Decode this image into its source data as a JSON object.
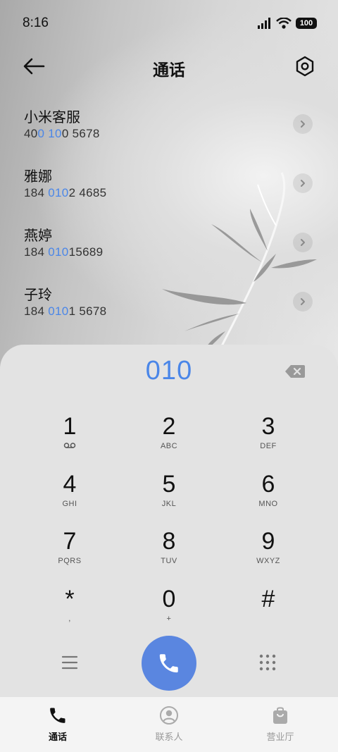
{
  "status_bar": {
    "time": "8:16",
    "battery": "100"
  },
  "header": {
    "title": "通话"
  },
  "results": [
    {
      "name": "小米客服",
      "number_parts": [
        "40",
        "0 10",
        "0 5678"
      ]
    },
    {
      "name": "雅娜",
      "number_parts": [
        "184 ",
        "010",
        "2 4685"
      ]
    },
    {
      "name": "燕婷",
      "number_parts": [
        "184 ",
        "010",
        "15689"
      ]
    },
    {
      "name": "子玲",
      "number_parts": [
        "184 ",
        "010",
        "1 5678"
      ]
    }
  ],
  "dialer": {
    "input": "010",
    "keys": [
      {
        "digit": "1",
        "letters": ""
      },
      {
        "digit": "2",
        "letters": "ABC"
      },
      {
        "digit": "3",
        "letters": "DEF"
      },
      {
        "digit": "4",
        "letters": "GHI"
      },
      {
        "digit": "5",
        "letters": "JKL"
      },
      {
        "digit": "6",
        "letters": "MNO"
      },
      {
        "digit": "7",
        "letters": "PQRS"
      },
      {
        "digit": "8",
        "letters": "TUV"
      },
      {
        "digit": "9",
        "letters": "WXYZ"
      },
      {
        "digit": "*",
        "letters": ","
      },
      {
        "digit": "0",
        "letters": "+"
      },
      {
        "digit": "#",
        "letters": ""
      }
    ]
  },
  "tabs": [
    {
      "label": "通话",
      "icon": "phone-icon",
      "active": true
    },
    {
      "label": "联系人",
      "icon": "contact-icon",
      "active": false
    },
    {
      "label": "营业厅",
      "icon": "shopping-bag-icon",
      "active": false
    }
  ],
  "colors": {
    "accent": "#4a86e8",
    "call_button": "#5a86e0",
    "panel": "#e3e3e3"
  }
}
